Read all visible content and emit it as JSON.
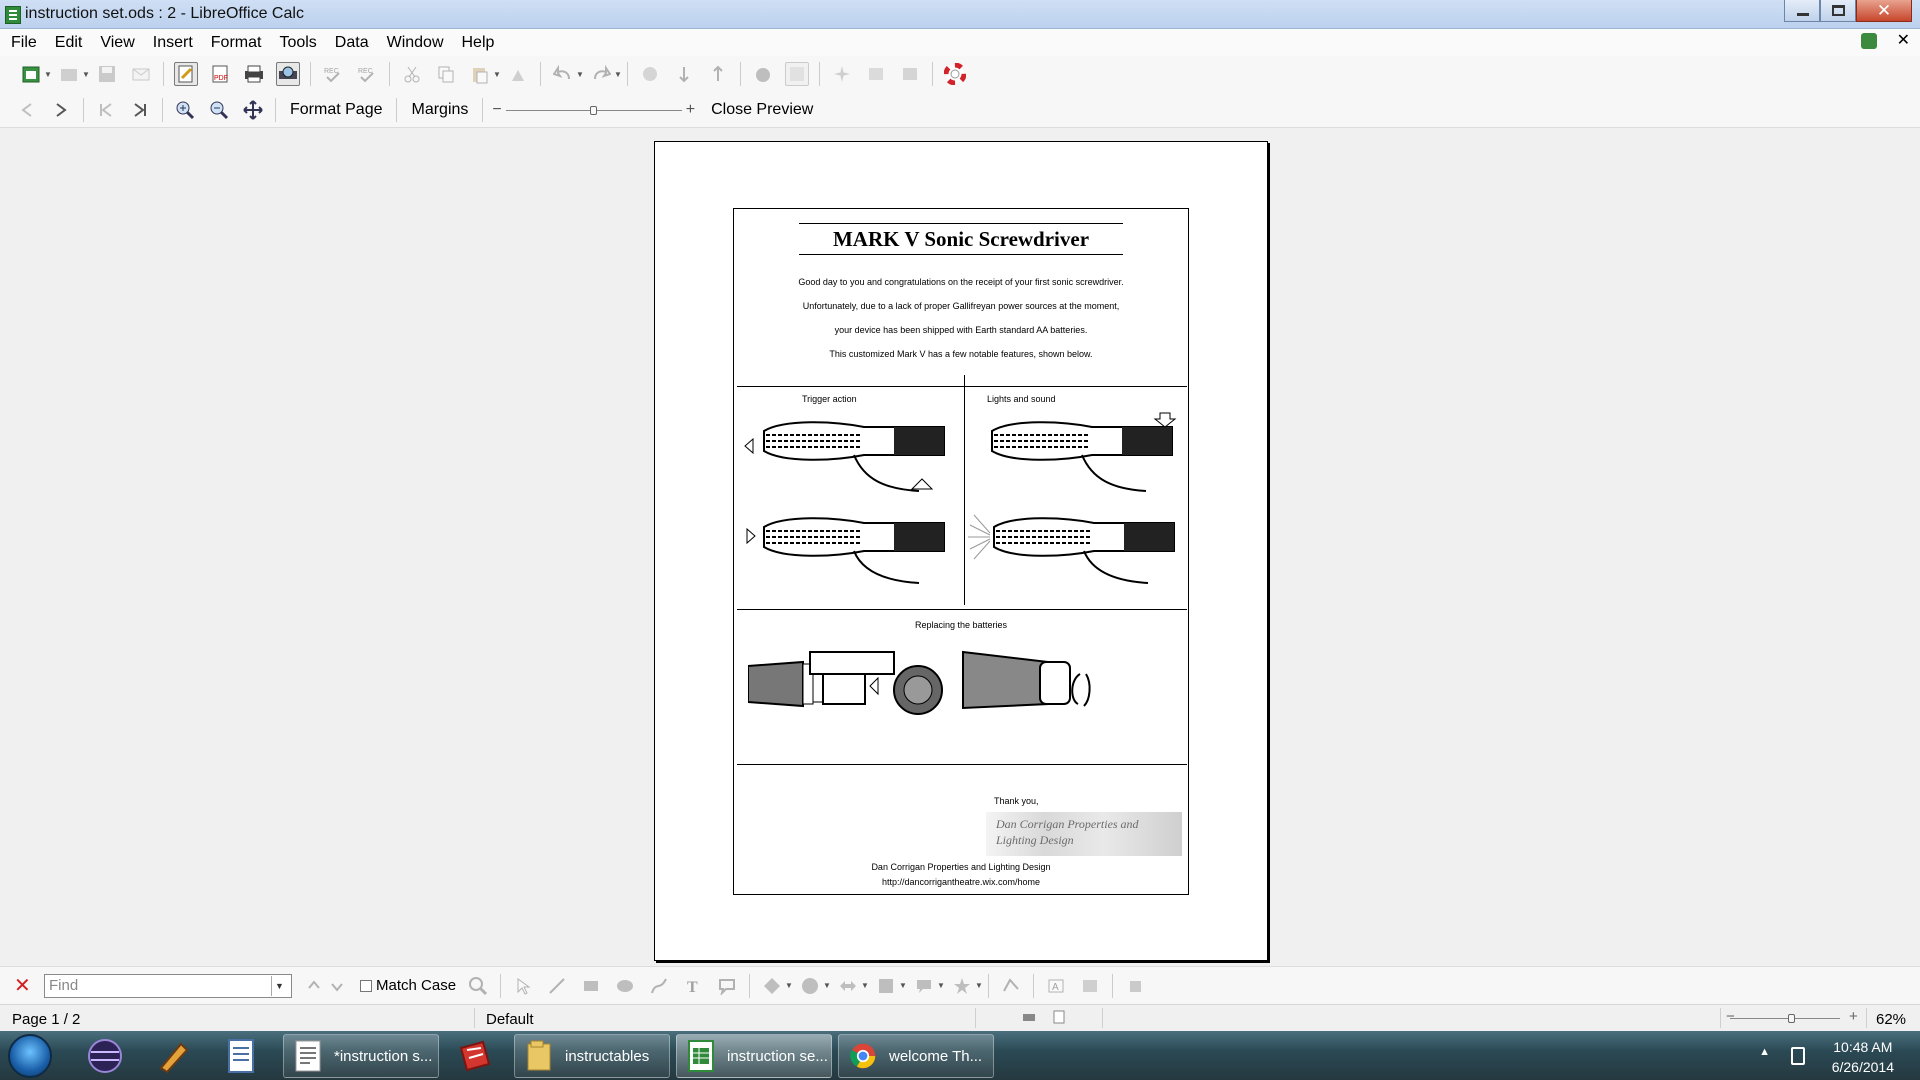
{
  "window": {
    "title": "instruction set.ods : 2 - LibreOffice Calc"
  },
  "menu": {
    "items": [
      "File",
      "Edit",
      "View",
      "Insert",
      "Format",
      "Tools",
      "Data",
      "Window",
      "Help"
    ]
  },
  "preview_toolbar": {
    "format_page_label": "Format Page",
    "margins_label": "Margins",
    "zoom_minus": "−",
    "zoom_plus": "+",
    "close_preview_label": "Close Preview"
  },
  "document": {
    "title": "MARK V Sonic Screwdriver",
    "intro_lines": [
      "Good day to you and congratulations on the receipt of your first sonic screwdriver.",
      "Unfortunately, due to a lack of proper Gallifreyan power sources at the moment,",
      "your device has been shipped with Earth standard AA batteries.",
      "This customized Mark V has a few notable features, shown below."
    ],
    "captions": {
      "trigger": "Trigger action",
      "lights": "Lights and sound",
      "batteries": "Replacing the batteries"
    },
    "thanks": "Thank you,",
    "signature": "Dan Corrigan Properties and Lighting Design",
    "company": "Dan Corrigan Properties and Lighting Design",
    "url": "http://dancorrigantheatre.wix.com/home"
  },
  "find_bar": {
    "placeholder": "Find",
    "match_case_label": "Match Case"
  },
  "status": {
    "page": "Page 1 / 2",
    "style": "Default",
    "zoom": "62%",
    "zoom_level": 0.62
  },
  "taskbar": {
    "tasks": [
      {
        "label": "*instruction s..."
      },
      {
        "label": "instructables"
      },
      {
        "label": "instruction se..."
      },
      {
        "label": "welcome Th..."
      }
    ],
    "time": "10:48 AM",
    "date": "6/26/2014"
  },
  "icons": {
    "trigger_arrows": [
      "left-arrow-icon",
      "up-arrow-icon"
    ],
    "lights_arrows": [
      "down-arrow-icon"
    ]
  },
  "colors": {
    "titlebar": "#c6d9f1",
    "workspace": "#f0f0f0",
    "close_button": "#c7462c",
    "find_close": "#d02020"
  }
}
